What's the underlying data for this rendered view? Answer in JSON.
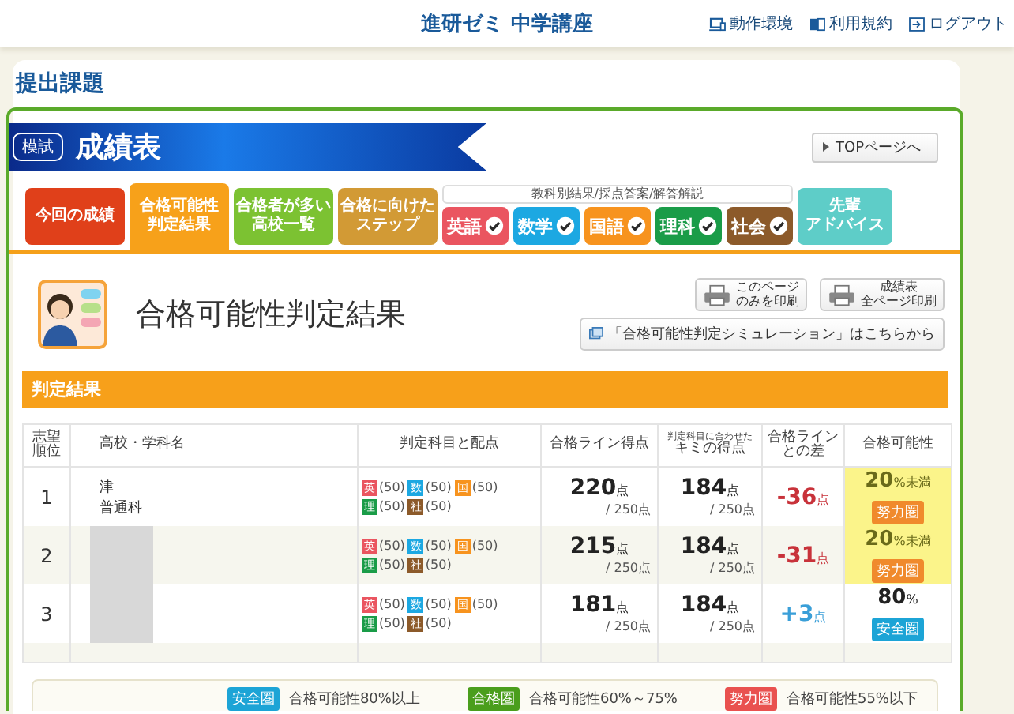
{
  "header": {
    "title": "進研ゼミ 中学講座",
    "links": [
      {
        "label": "動作環境",
        "kind": "device"
      },
      {
        "label": "利用規約",
        "kind": "book"
      },
      {
        "label": "ログアウト",
        "kind": "logout"
      }
    ]
  },
  "page_title": "提出課題",
  "banner": {
    "badge": "模試",
    "title": "成績表"
  },
  "top_button": "TOPページへ",
  "tabs": [
    {
      "lines": [
        "今回の成績"
      ],
      "color": "#e0401a",
      "selected": false
    },
    {
      "lines": [
        "合格可能性",
        "判定結果"
      ],
      "color": "#f7a11a",
      "selected": true
    },
    {
      "lines": [
        "合格者が多い",
        "高校一覧"
      ],
      "color": "#7cc232",
      "selected": false
    },
    {
      "lines": [
        "合格に向けた",
        "ステップ"
      ],
      "color": "#d29a35",
      "selected": false
    }
  ],
  "subject_group": {
    "caption": "教科別結果/採点答案/解答解説",
    "subjects": [
      {
        "label": "英語",
        "color": "#ea5560",
        "checked": true
      },
      {
        "label": "数学",
        "color": "#1ca8e2",
        "checked": true
      },
      {
        "label": "国語",
        "color": "#f7931e",
        "checked": true
      },
      {
        "label": "理科",
        "color": "#1a9c48",
        "checked": true
      },
      {
        "label": "社会",
        "color": "#8c5a2a",
        "checked": true
      }
    ]
  },
  "advice_tab": {
    "lines": [
      "先輩",
      "アドバイス"
    ]
  },
  "section": {
    "title": "合格可能性判定結果",
    "print_buttons": [
      {
        "lines": [
          "このページ",
          "のみを印刷"
        ]
      },
      {
        "lines": [
          "成績表",
          "全ページ印刷"
        ]
      }
    ],
    "simulation_link": "「合格可能性判定シミュレーション」はこちらから"
  },
  "result_bar": "判定結果",
  "table": {
    "columns": [
      {
        "lines": [
          "志望",
          "順位"
        ]
      },
      {
        "lines": [
          "高校・学科名"
        ]
      },
      {
        "lines": [
          "判定科目と配点"
        ]
      },
      {
        "lines": [
          "合格ライン得点"
        ]
      },
      {
        "note": "判定科目に合わせた",
        "lines": [
          "キミの得点"
        ]
      },
      {
        "lines": [
          "合格ライン",
          "との差"
        ]
      },
      {
        "lines": [
          "合格可能性"
        ]
      }
    ],
    "rows": [
      {
        "rank": "1",
        "school": "津",
        "course": "普通科",
        "redacted": false,
        "subjects": [
          {
            "label": "英",
            "color": "#ea5560",
            "points": "(50)"
          },
          {
            "label": "数",
            "color": "#1ca8e2",
            "points": "(50)"
          },
          {
            "label": "国",
            "color": "#f7931e",
            "points": "(50)"
          },
          {
            "label": "理",
            "color": "#1a9c48",
            "points": "(50)"
          },
          {
            "label": "社",
            "color": "#8c5a2a",
            "points": "(50)"
          }
        ],
        "line_score": {
          "value": "220",
          "unit": "点",
          "max": "/ 250点"
        },
        "my_score": {
          "value": "184",
          "unit": "点",
          "max": "/ 250点"
        },
        "diff": {
          "value": "-36",
          "unit": "点",
          "kind": "minus"
        },
        "chance": {
          "value": "20",
          "unit": "%未満"
        },
        "badge": {
          "label": "努力圏",
          "color": "#f08a2c"
        },
        "highlighted": true
      },
      {
        "rank": "2",
        "redacted": true,
        "subjects": [
          {
            "label": "英",
            "color": "#ea5560",
            "points": "(50)"
          },
          {
            "label": "数",
            "color": "#1ca8e2",
            "points": "(50)"
          },
          {
            "label": "国",
            "color": "#f7931e",
            "points": "(50)"
          },
          {
            "label": "理",
            "color": "#1a9c48",
            "points": "(50)"
          },
          {
            "label": "社",
            "color": "#8c5a2a",
            "points": "(50)"
          }
        ],
        "line_score": {
          "value": "215",
          "unit": "点",
          "max": "/ 250点"
        },
        "my_score": {
          "value": "184",
          "unit": "点",
          "max": "/ 250点"
        },
        "diff": {
          "value": "-31",
          "unit": "点",
          "kind": "minus"
        },
        "chance": {
          "value": "20",
          "unit": "%未満"
        },
        "badge": {
          "label": "努力圏",
          "color": "#f08a2c"
        },
        "highlighted": true
      },
      {
        "rank": "3",
        "redacted": true,
        "subjects": [
          {
            "label": "英",
            "color": "#ea5560",
            "points": "(50)"
          },
          {
            "label": "数",
            "color": "#1ca8e2",
            "points": "(50)"
          },
          {
            "label": "国",
            "color": "#f7931e",
            "points": "(50)"
          },
          {
            "label": "理",
            "color": "#1a9c48",
            "points": "(50)"
          },
          {
            "label": "社",
            "color": "#8c5a2a",
            "points": "(50)"
          }
        ],
        "line_score": {
          "value": "181",
          "unit": "点",
          "max": "/ 250点"
        },
        "my_score": {
          "value": "184",
          "unit": "点",
          "max": "/ 250点"
        },
        "diff": {
          "value": "+3",
          "unit": "点",
          "kind": "plus"
        },
        "chance": {
          "value": "80",
          "unit": "%"
        },
        "badge": {
          "label": "安全圏",
          "color": "#1ca4d6"
        },
        "highlighted": false
      }
    ]
  },
  "legend": [
    {
      "badge": "安全圏",
      "color": "#1ca4d6",
      "text": "合格可能性80%以上"
    },
    {
      "badge": "合格圏",
      "color": "#4a9e1c",
      "text": "合格可能性60%～75%"
    },
    {
      "badge": "努力圏",
      "color": "#e9514f",
      "text": "合格可能性55%以下"
    }
  ]
}
